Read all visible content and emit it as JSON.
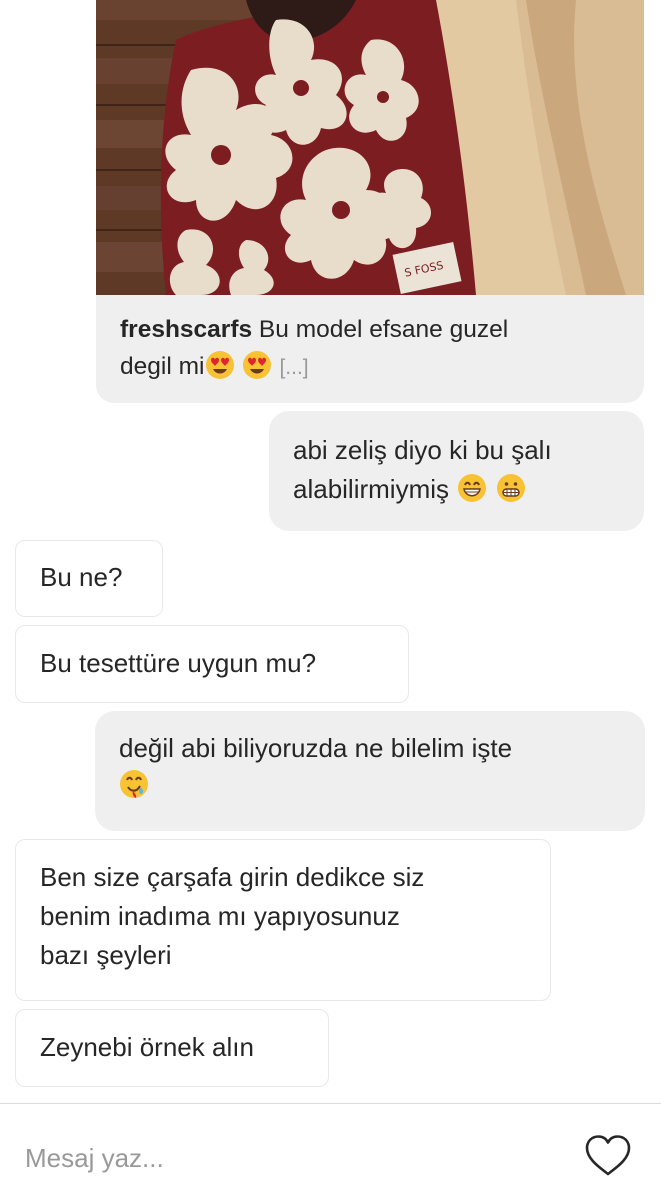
{
  "shared_post": {
    "username": "freshscarfs",
    "caption_line1": "Bu model efsane guzel",
    "caption_line2": "degil mi",
    "more": "[...]"
  },
  "messages": [
    {
      "direction": "outgoing",
      "lines": [
        "abi zeliş diyo ki bu şalı",
        "alabilirmiymiş"
      ],
      "emoji": [
        "grinning-face-with-smiling-eyes",
        "grimacing-face"
      ]
    },
    {
      "direction": "incoming",
      "lines": [
        "Bu ne?"
      ]
    },
    {
      "direction": "incoming",
      "lines": [
        "Bu tesettüre uygun mu?"
      ]
    },
    {
      "direction": "outgoing",
      "lines": [
        "değil abi biliyoruzda ne bilelim işte",
        ""
      ],
      "emoji": [
        "drooling-face"
      ]
    },
    {
      "direction": "incoming",
      "lines": [
        "Ben size çarşafa girin dedikce siz",
        "benim inadıma mı yapıyosunuz",
        "bazı şeyleri"
      ]
    },
    {
      "direction": "incoming",
      "lines": [
        "Zeynebi örnek alın"
      ]
    }
  ],
  "composer": {
    "placeholder": "Mesaj yaz...",
    "icon": "heart-icon"
  },
  "colors": {
    "outgoing_bubble": "#efefef",
    "incoming_border": "#e8e8e8",
    "text": "#262626",
    "placeholder": "#999999",
    "scarf_red": "#7c1d22",
    "scarf_cream": "#e8dccb",
    "wood": "#5e3926"
  }
}
